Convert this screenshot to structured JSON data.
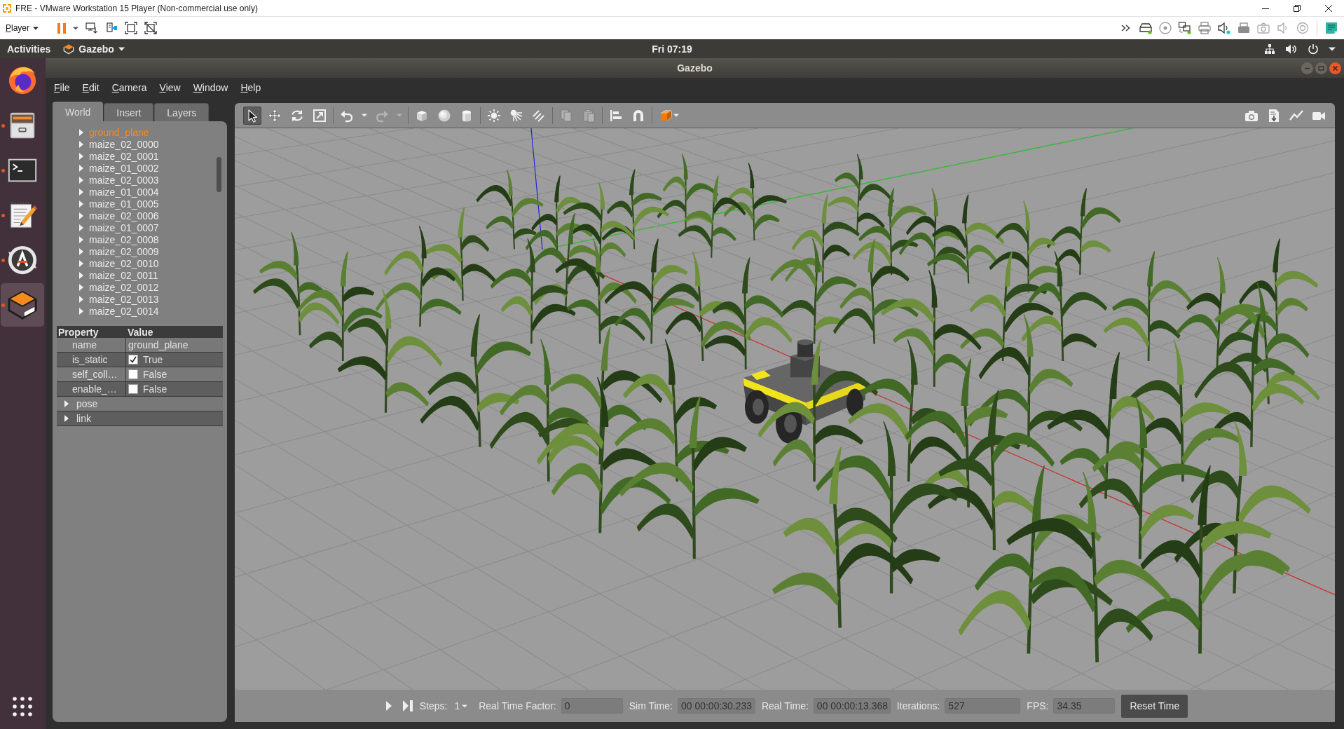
{
  "vm_window": {
    "title": "FRE - VMware Workstation 15 Player (Non-commercial use only)",
    "menu": "Player"
  },
  "topbar": {
    "activities": "Activities",
    "app_menu": "Gazebo",
    "clock": "Fri 07:19"
  },
  "dock": [
    {
      "kind": "browser",
      "running": false,
      "selected": false
    },
    {
      "kind": "files",
      "running": true,
      "selected": false
    },
    {
      "kind": "terminal",
      "running": true,
      "selected": false
    },
    {
      "kind": "text-editor",
      "running": true,
      "selected": false
    },
    {
      "kind": "software-updater",
      "running": true,
      "selected": false
    },
    {
      "kind": "gazebo",
      "running": true,
      "selected": true
    }
  ],
  "window": {
    "title": "Gazebo",
    "menu": [
      "File",
      "Edit",
      "Camera",
      "View",
      "Window",
      "Help"
    ]
  },
  "left_panel": {
    "tabs": [
      {
        "label": "World",
        "selected": true
      },
      {
        "label": "Insert",
        "selected": false
      },
      {
        "label": "Layers",
        "selected": false
      }
    ],
    "tree": [
      {
        "label": "ground_plane",
        "selected": true,
        "expanded": false
      },
      {
        "label": "maize_02_0000",
        "selected": false,
        "expanded": false
      },
      {
        "label": "maize_02_0001",
        "selected": false,
        "expanded": false
      },
      {
        "label": "maize_01_0002",
        "selected": false,
        "expanded": false
      },
      {
        "label": "maize_02_0003",
        "selected": false,
        "expanded": false
      },
      {
        "label": "maize_01_0004",
        "selected": false,
        "expanded": false
      },
      {
        "label": "maize_01_0005",
        "selected": false,
        "expanded": false
      },
      {
        "label": "maize_02_0006",
        "selected": false,
        "expanded": false
      },
      {
        "label": "maize_01_0007",
        "selected": false,
        "expanded": false
      },
      {
        "label": "maize_02_0008",
        "selected": false,
        "expanded": false
      },
      {
        "label": "maize_02_0009",
        "selected": false,
        "expanded": false
      },
      {
        "label": "maize_02_0010",
        "selected": false,
        "expanded": false
      },
      {
        "label": "maize_02_0011",
        "selected": false,
        "expanded": false
      },
      {
        "label": "maize_02_0012",
        "selected": false,
        "expanded": false
      },
      {
        "label": "maize_02_0013",
        "selected": false,
        "expanded": false
      },
      {
        "label": "maize_02_0014",
        "selected": false,
        "expanded": false
      }
    ],
    "properties": {
      "columns": [
        "Property",
        "Value"
      ],
      "rows": [
        {
          "kind": "text",
          "name": "name",
          "value": "ground_plane"
        },
        {
          "kind": "checkbox",
          "name": "is_static",
          "value": "True",
          "checked": true
        },
        {
          "kind": "checkbox",
          "name": "self_coll…",
          "value": "False",
          "checked": false
        },
        {
          "kind": "checkbox",
          "name": "enable_…",
          "value": "False",
          "checked": false
        },
        {
          "kind": "group",
          "name": "pose",
          "expanded": false
        },
        {
          "kind": "group",
          "name": "link",
          "expanded": false
        }
      ]
    }
  },
  "toolbar": {
    "groups": [
      [
        {
          "kind": "select",
          "selected": true,
          "disabled": false
        },
        {
          "kind": "translate",
          "selected": false,
          "disabled": false
        },
        {
          "kind": "rotate",
          "selected": false,
          "disabled": false
        },
        {
          "kind": "scale",
          "selected": false,
          "disabled": false
        }
      ],
      [
        {
          "kind": "undo",
          "disabled": false
        },
        {
          "kind": "undo-menu",
          "disabled": false
        },
        {
          "kind": "redo",
          "disabled": true
        },
        {
          "kind": "redo-menu",
          "disabled": true
        }
      ],
      [
        {
          "kind": "box",
          "disabled": false
        },
        {
          "kind": "sphere",
          "disabled": false
        },
        {
          "kind": "cylinder",
          "disabled": false
        }
      ],
      [
        {
          "kind": "point-light",
          "disabled": false
        },
        {
          "kind": "spot-light",
          "disabled": false
        },
        {
          "kind": "directional-light",
          "disabled": false
        }
      ],
      [
        {
          "kind": "copy",
          "disabled": true
        },
        {
          "kind": "paste",
          "disabled": true
        }
      ],
      [
        {
          "kind": "align",
          "disabled": false
        },
        {
          "kind": "snap",
          "disabled": false
        }
      ],
      [
        {
          "kind": "view-angle",
          "disabled": false
        }
      ]
    ],
    "right": [
      {
        "kind": "screenshot",
        "disabled": false
      },
      {
        "kind": "log",
        "disabled": false
      },
      {
        "kind": "plot",
        "disabled": false
      },
      {
        "kind": "record",
        "disabled": false
      }
    ]
  },
  "sim_controls": {
    "paused": true,
    "steps_label": "Steps:",
    "steps": "1",
    "stats": [
      {
        "label": "Real Time Factor:",
        "value": "0"
      },
      {
        "label": "Sim Time:",
        "value": "00 00:00:30.233"
      },
      {
        "label": "Real Time:",
        "value": "00 00:00:13.368"
      },
      {
        "label": "Iterations:",
        "value": "527"
      },
      {
        "label": "FPS:",
        "value": "34.35"
      }
    ],
    "reset_button": "Reset Time"
  }
}
